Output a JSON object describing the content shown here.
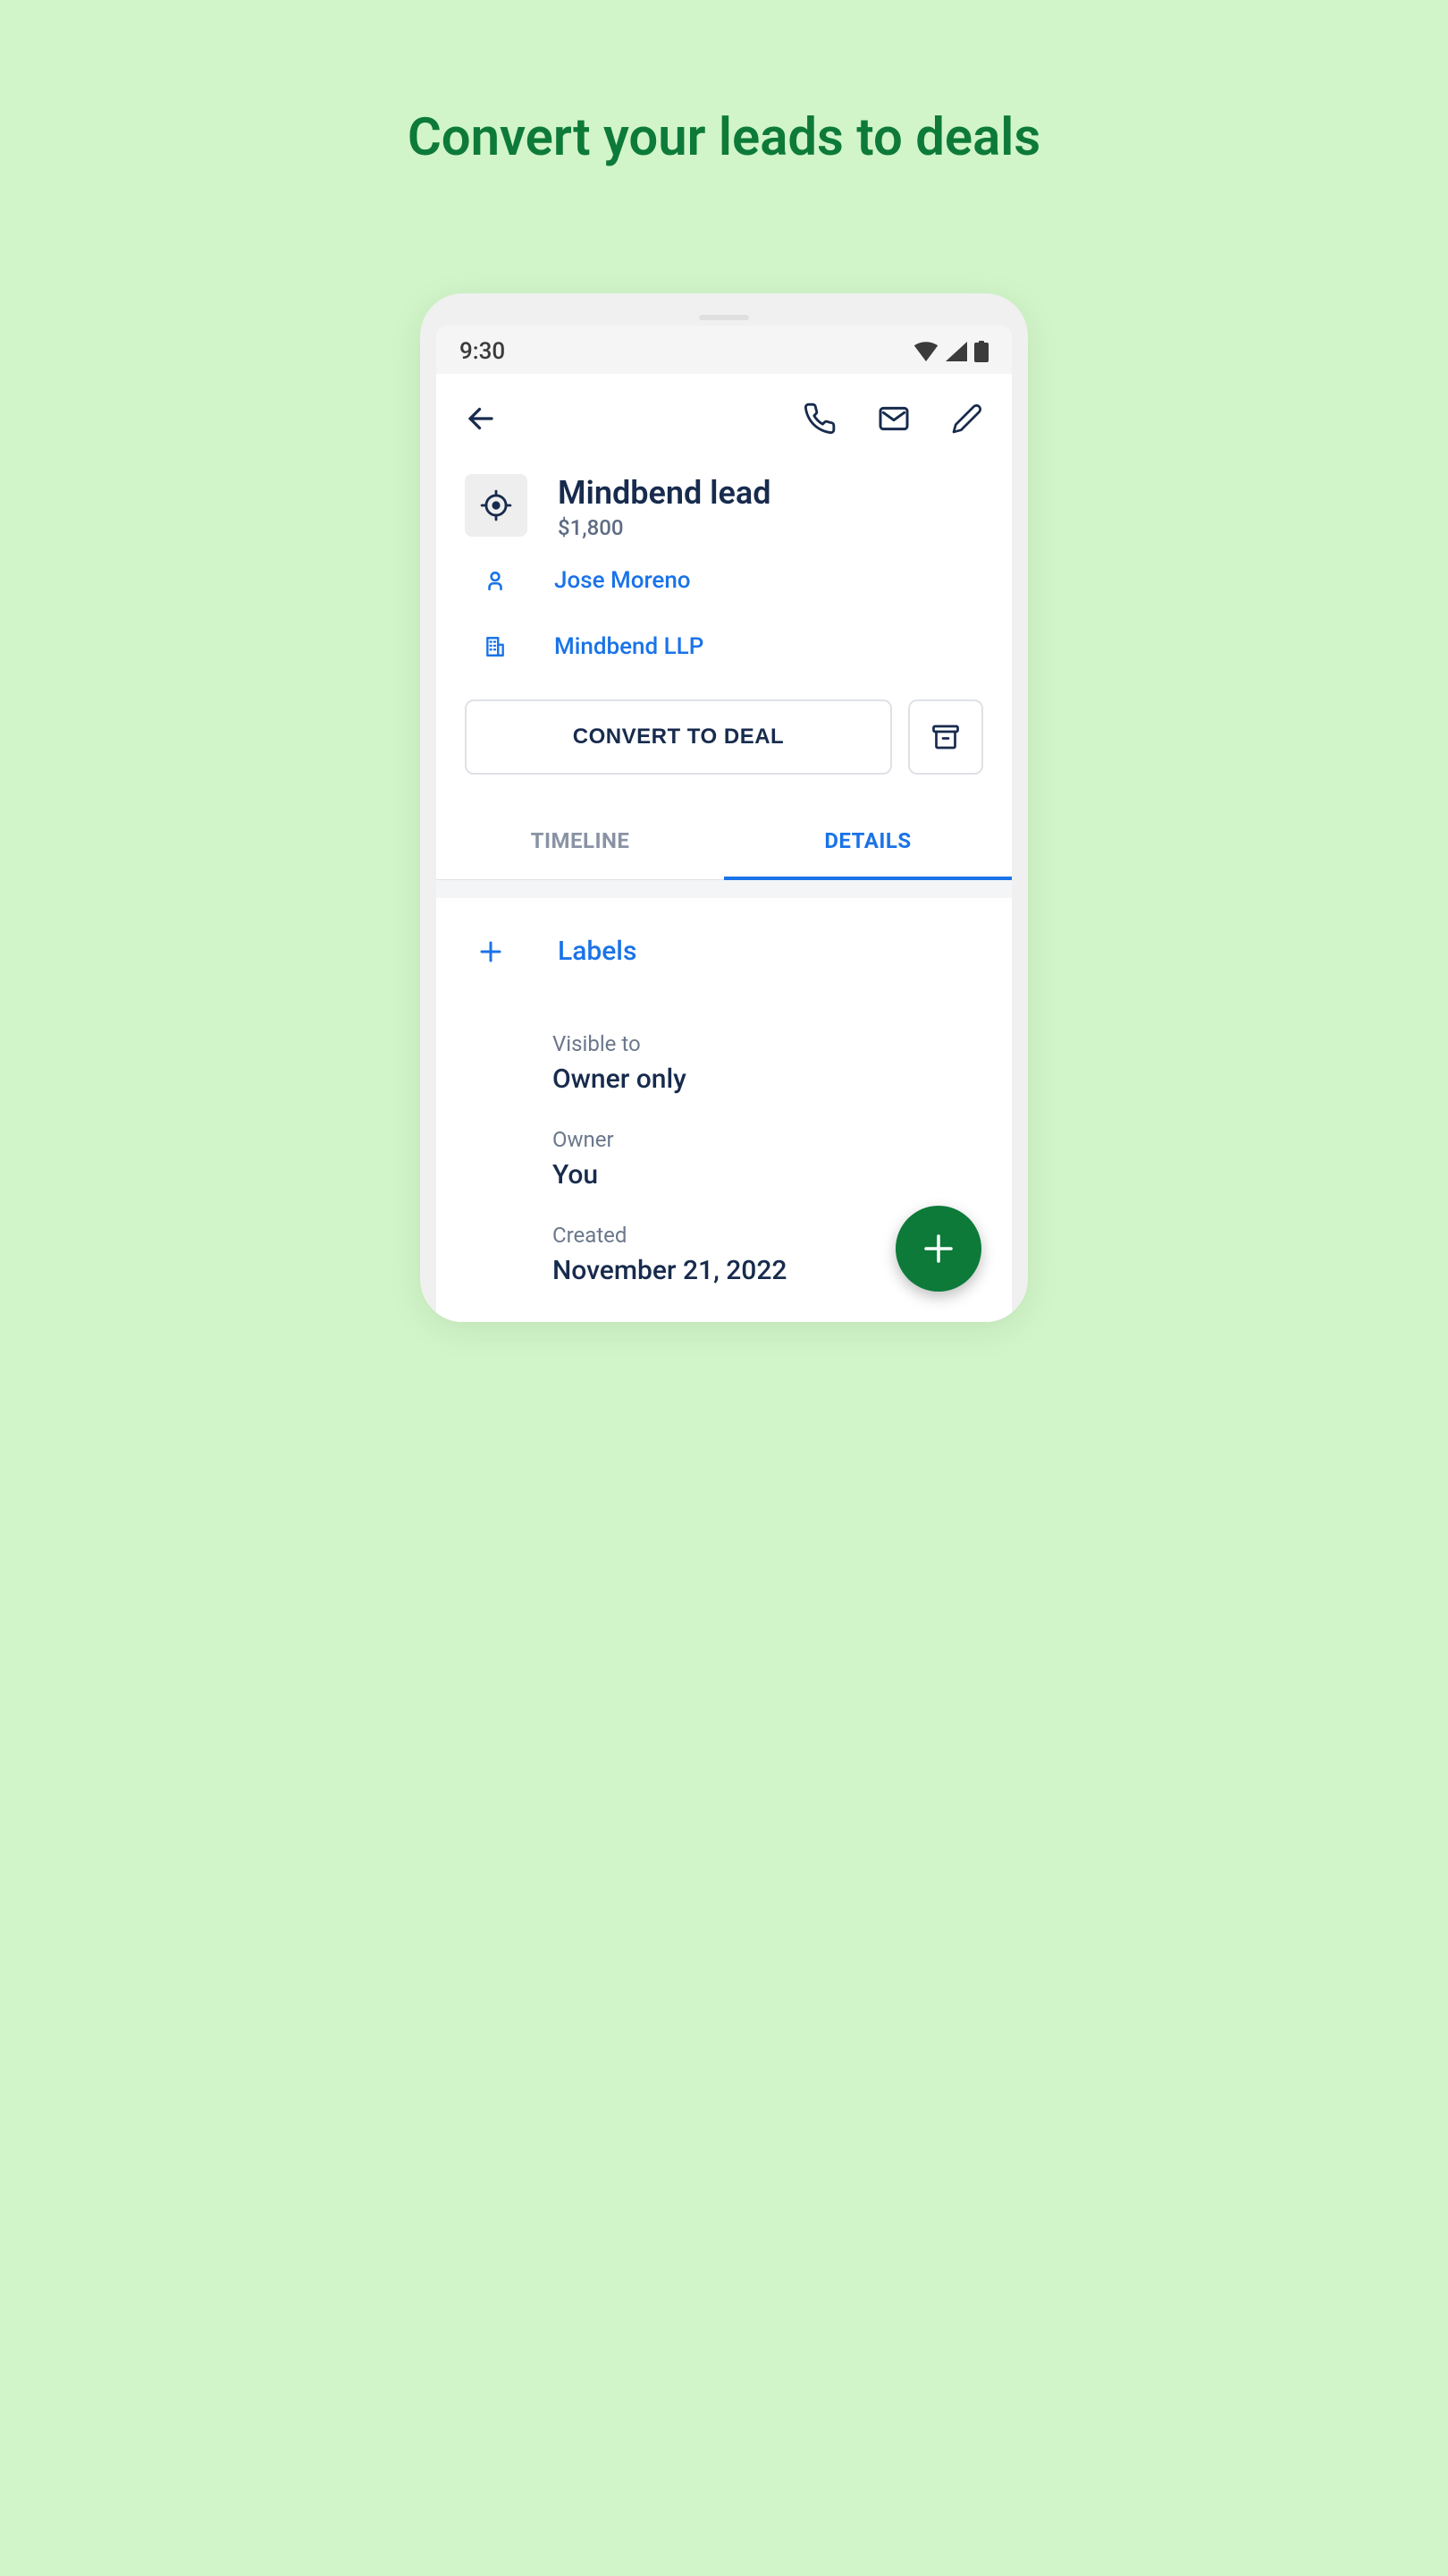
{
  "headline": "Convert your leads to deals",
  "statusbar": {
    "time": "9:30"
  },
  "lead": {
    "title": "Mindbend lead",
    "amount": "$1,800",
    "contact_name": "Jose Moreno",
    "org_name": "Mindbend LLP"
  },
  "actions": {
    "convert_label": "CONVERT TO DEAL"
  },
  "tabs": {
    "timeline": "TIMELINE",
    "details": "DETAILS"
  },
  "labels": {
    "heading": "Labels"
  },
  "fields": {
    "visible_label": "Visible to",
    "visible_value": "Owner only",
    "owner_label": "Owner",
    "owner_value": "You",
    "created_label": "Created",
    "created_value": "November 21, 2022"
  }
}
